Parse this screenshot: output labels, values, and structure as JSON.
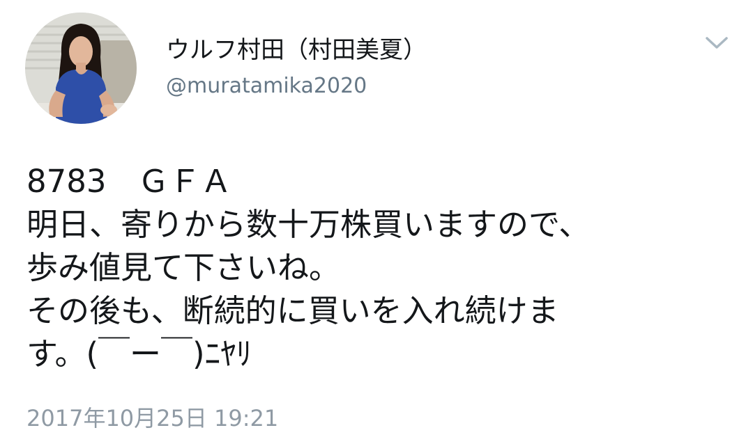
{
  "author": {
    "display_name": "ウルフ村田（村田美夏）",
    "handle": "@muratamika2020",
    "avatar_icon": "profile-photo"
  },
  "menu_icon": "chevron-down-icon",
  "tweet": {
    "text": "8783　ＧＦＡ\n明日、寄りから数十万株買いますので、\n歩み値見て下さいね。\nその後も、断続的に買いを入れ続けま\nす。(￣ー￣)ﾆﾔﾘ",
    "timestamp": "2017年10月25日 19:21"
  },
  "colors": {
    "text": "#14171a",
    "secondary": "#657786",
    "timestamp": "#8f9aa4",
    "chevron": "#aab8c2"
  }
}
